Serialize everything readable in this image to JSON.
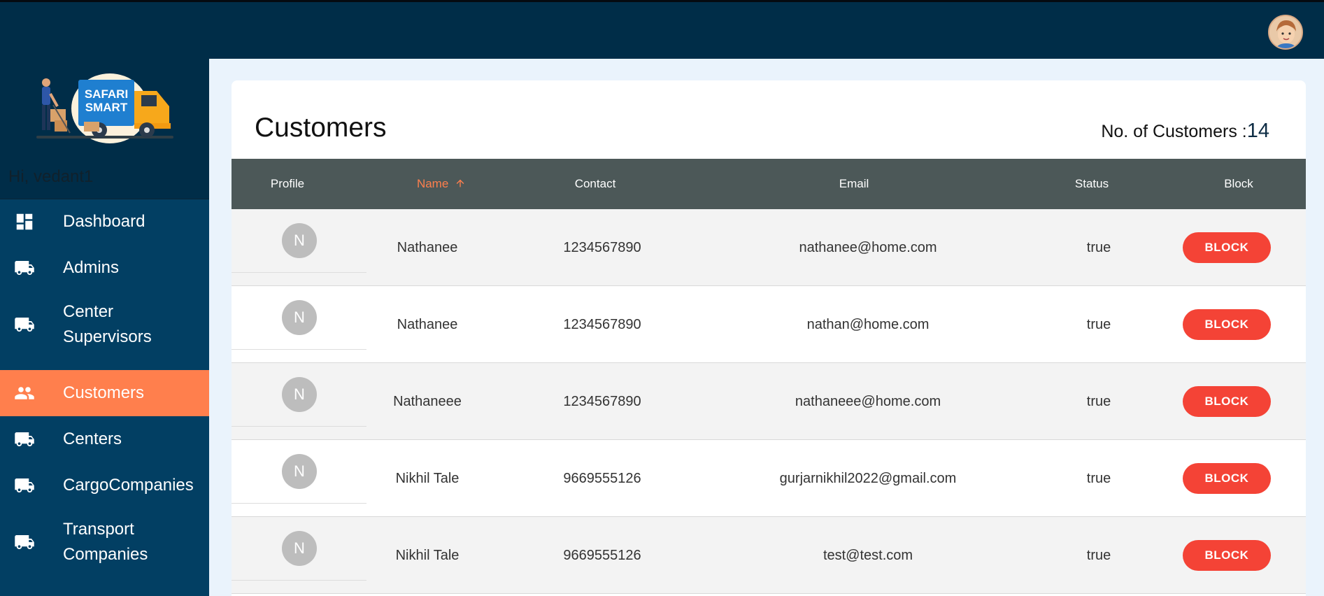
{
  "sidebar": {
    "logo_text": [
      "SAFARI",
      "SMART"
    ],
    "greeting": "Hi, vedant1",
    "items": [
      {
        "label": "Dashboard",
        "icon": "dashboard-icon"
      },
      {
        "label": "Admins",
        "icon": "truck-icon"
      },
      {
        "label": "Center Supervisors",
        "icon": "truck-icon"
      },
      {
        "label": "Customers",
        "icon": "people-icon",
        "active": true
      },
      {
        "label": "Centers",
        "icon": "truck-icon"
      },
      {
        "label": "CargoCompanies",
        "icon": "truck-icon"
      },
      {
        "label": "Transport Companies",
        "icon": "truck-icon"
      }
    ]
  },
  "main": {
    "title": "Customers",
    "count_label": "No. of Customers :",
    "count_value": "14"
  },
  "table": {
    "columns": [
      "Profile",
      "Name",
      "Contact",
      "Email",
      "Status",
      "Block"
    ],
    "sorted_column": "Name",
    "sort_icon": "arrow-up-icon",
    "rows": [
      {
        "initial": "N",
        "name": "Nathanee",
        "contact": "1234567890",
        "email": "nathanee@home.com",
        "status": "true",
        "action": "BLOCK"
      },
      {
        "initial": "N",
        "name": "Nathanee",
        "contact": "1234567890",
        "email": "nathan@home.com",
        "status": "true",
        "action": "BLOCK"
      },
      {
        "initial": "N",
        "name": "Nathaneee",
        "contact": "1234567890",
        "email": "nathaneee@home.com",
        "status": "true",
        "action": "BLOCK"
      },
      {
        "initial": "N",
        "name": "Nikhil Tale",
        "contact": "9669555126",
        "email": "gurjarnikhil2022@gmail.com",
        "status": "true",
        "action": "BLOCK"
      },
      {
        "initial": "N",
        "name": "Nikhil Tale",
        "contact": "9669555126",
        "email": "test@test.com",
        "status": "true",
        "action": "BLOCK"
      }
    ]
  },
  "colors": {
    "topbar": "#002d48",
    "sidebar": "#023f63",
    "active": "#ff7f4d",
    "header_row": "#4c5858",
    "block_button": "#f44336"
  }
}
